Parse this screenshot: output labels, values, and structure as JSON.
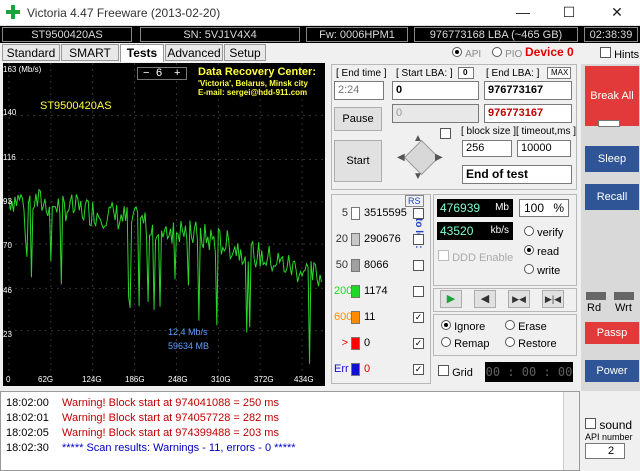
{
  "window": {
    "title": "Victoria 4.47  Freeware (2013-02-20)",
    "min": "—",
    "max": "☐",
    "close": "✕"
  },
  "info": {
    "model": "ST9500420AS",
    "serial": "SN: 5VJ1V4X4",
    "firmware": "Fw: 0006HPM1",
    "lba": "976773168 LBA (~465 GB)",
    "clock": "02:38:39"
  },
  "tabs": [
    "Standard",
    "SMART",
    "Tests",
    "Advanced",
    "Setup"
  ],
  "active_tab": "Tests",
  "api": {
    "api_label": "API",
    "pio_label": "PIO",
    "device": "Device 0",
    "hints": "Hints"
  },
  "graph": {
    "ymax_label": "163 (Mb/s)",
    "drive_label": "ST9500420AS",
    "step": "6",
    "minus": "−",
    "plus": "+",
    "center_title": "Data Recovery Center:",
    "center_line2": "'Victoria', Belarus, Minsk city",
    "center_line3": "E-mail: sergei@hdd-911.com",
    "yticks": [
      "140",
      "116",
      "93",
      "70",
      "46",
      "23"
    ],
    "xticks": [
      "0",
      "62G",
      "124G",
      "186G",
      "248G",
      "310G",
      "372G",
      "434G"
    ],
    "speed_readout": "12,4 Mb/s",
    "mb_readout": "59634 MB"
  },
  "chart_data": {
    "type": "line",
    "ylabel": "(Mb/s)",
    "ylim": [
      0,
      163
    ],
    "x": [
      0,
      31,
      62,
      93,
      124,
      155,
      186,
      217,
      248,
      279,
      310,
      341,
      372,
      403,
      434,
      465
    ],
    "series": [
      {
        "values": [
          93,
          92,
          90,
          88,
          86,
          84,
          81,
          78,
          76,
          73,
          70,
          66,
          62,
          58,
          54,
          50
        ]
      }
    ],
    "color": "#2bd62b"
  },
  "controls": {
    "end_time_label": "[ End time ]",
    "end_time": "2:24",
    "start_lba_label": "[ Start LBA: ]",
    "start_lba_zero": "0",
    "start_lba": "0",
    "end_lba_label": "[ End LBA: ]",
    "end_lba_max": "MAX",
    "end_lba": "976773167",
    "end_lba2": "976773167",
    "cur_lba": "0",
    "pause": "Pause",
    "start": "Start",
    "block_size_label": "[ block size ]",
    "block_size": "256",
    "timeout_label": "[ timeout,ms ]",
    "timeout": "10000",
    "end_action": "End of test"
  },
  "stats": {
    "rs": "RS",
    "to_log": "to log:",
    "rows": [
      {
        "label": "5",
        "count": "3515595",
        "color": "#ffffff",
        "checked": false
      },
      {
        "label": "20",
        "count": "290676",
        "color": "#c8c8c8",
        "checked": false
      },
      {
        "label": "50",
        "count": "8066",
        "color": "#a0a0a0",
        "checked": false
      },
      {
        "label": "200",
        "count": "1174",
        "color": "#1fd81f",
        "checked": false
      },
      {
        "label": "600",
        "count": "11",
        "color": "#ff8c00",
        "checked": true
      },
      {
        "label": ">",
        "count": "0",
        "color": "#ff0000",
        "checked": true
      },
      {
        "label": "Err",
        "count": "0",
        "color": "#1010d0",
        "checked": true
      }
    ]
  },
  "progress": {
    "mb": "476939",
    "mb_unit": "Mb",
    "percent": "100",
    "percent_unit": "%",
    "kbs": "43520",
    "kbs_unit": "kb/s",
    "verify": "verify",
    "read": "read",
    "write": "write",
    "ddd": "DDD Enable"
  },
  "modes": {
    "ignore": "Ignore",
    "erase": "Erase",
    "remap": "Remap",
    "restore": "Restore",
    "grid": "Grid",
    "timer": "00 : 00 : 00"
  },
  "right": {
    "break_all": "Break All",
    "sleep": "Sleep",
    "recall": "Recall",
    "rd": "Rd",
    "wrt": "Wrt",
    "passp": "Passp",
    "power": "Power",
    "sound": "sound",
    "api_number_label": "API number",
    "api_number": "2"
  },
  "log": [
    {
      "time": "18:02:00",
      "text": "Warning! Block start at 974041088 = 250 ms",
      "color": "#c00000"
    },
    {
      "time": "18:02:01",
      "text": "Warning! Block start at 974057728 = 282 ms",
      "color": "#c00000"
    },
    {
      "time": "18:02:05",
      "text": "Warning! Block start at 974399488 = 203 ms",
      "color": "#c00000"
    },
    {
      "time": "18:02:30",
      "text": "***** Scan results: Warnings - 11, errors - 0 *****",
      "color": "#0000c0"
    }
  ]
}
